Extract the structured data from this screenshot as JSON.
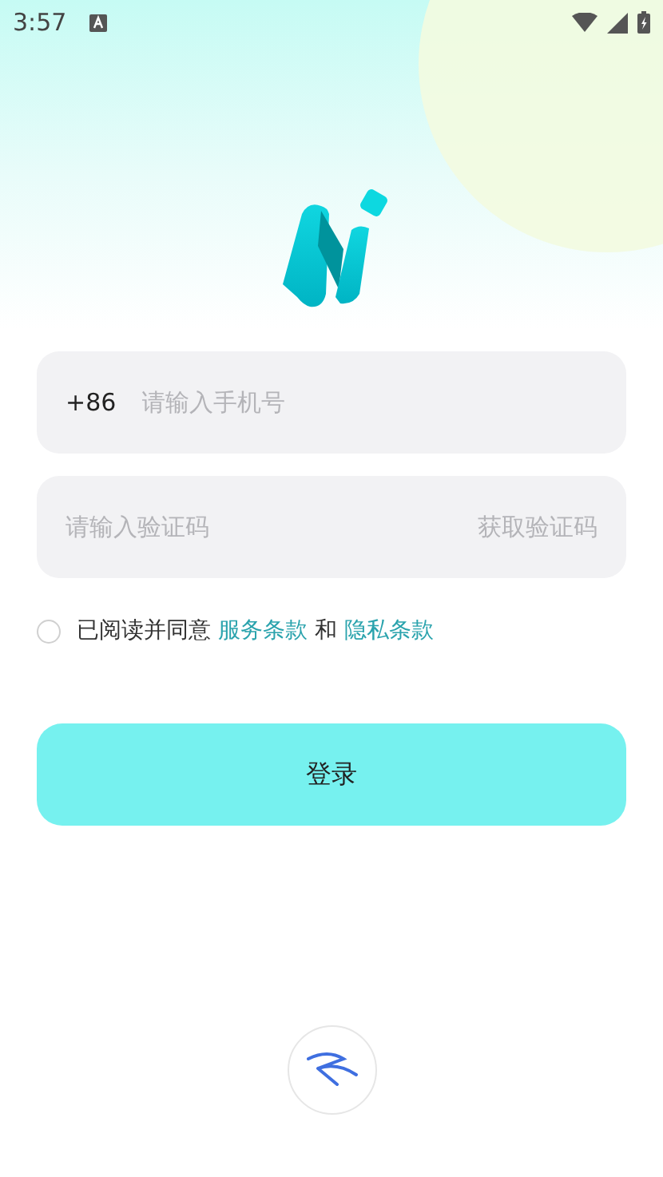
{
  "status_bar": {
    "time": "3:57"
  },
  "phone": {
    "country_code": "+86",
    "placeholder": "请输入手机号"
  },
  "code": {
    "placeholder": "请输入验证码",
    "send_code": "获取验证码"
  },
  "agreement": {
    "checked": false,
    "prefix": "已阅读并同意",
    "terms": "服务条款",
    "conjunction": "和",
    "privacy": "隐私条款"
  },
  "login_button": "登录"
}
